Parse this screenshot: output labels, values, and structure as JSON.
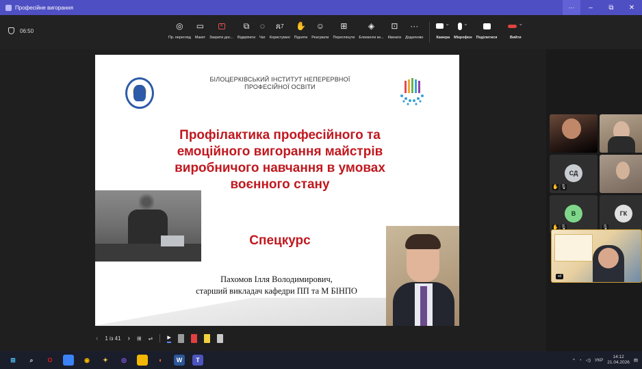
{
  "window": {
    "title": "Професійне вигорання",
    "more_label": "···",
    "minimize_label": "–",
    "restore_label": "⧉",
    "close_label": "✕"
  },
  "toolbar": {
    "timer": "06:50",
    "tools": [
      {
        "icon": "eye-icon",
        "glyph": "◎",
        "label": "Пр. перегляд"
      },
      {
        "icon": "layout-icon",
        "glyph": "▭",
        "label": "Макет"
      },
      {
        "icon": "close-share-icon",
        "glyph": "✕",
        "label": "Закрити дос..."
      },
      {
        "icon": "undock-icon",
        "glyph": "⧉",
        "label": "Відкріпити"
      },
      {
        "icon": "chat-icon",
        "glyph": "◌",
        "label": "Чат"
      },
      {
        "icon": "people-icon",
        "glyph": "ጸ",
        "label": "Користувачі",
        "count": "7"
      },
      {
        "icon": "raise-hand-icon",
        "glyph": "✋",
        "label": "Підняти"
      },
      {
        "icon": "react-icon",
        "glyph": "☺",
        "label": "Реагувати"
      },
      {
        "icon": "view-icon",
        "glyph": "⊞",
        "label": "Переглянути"
      },
      {
        "icon": "apps-icon",
        "glyph": "◈",
        "label": "Елементи ке..."
      },
      {
        "icon": "rooms-icon",
        "glyph": "⊡",
        "label": "Кімнати"
      },
      {
        "icon": "more-icon",
        "glyph": "···",
        "label": "Додатково"
      }
    ],
    "camera_label": "Камера",
    "mic_label": "Мікрофон",
    "share_label": "Поділитися",
    "leave_label": "Вийти"
  },
  "slide": {
    "institute_line1": "БІЛОЦЕРКІВСЬКИЙ ІНСТИТУТ НЕПЕРЕРВНОЇ",
    "institute_line2": "ПРОФЕСІЙНОЇ ОСВІТИ",
    "headline_1": "Профілактика професійного та",
    "headline_2": "емоційного вигорання майстрів",
    "headline_3": "виробничого навчання в умовах",
    "headline_4": "воєнного стану",
    "subtitle": "Спецкурс",
    "author_1": "Пахомов Ілля Володимирович,",
    "author_2": "старший викладач кафедри ПП та М БІНПО"
  },
  "participants": {
    "tiles": [
      {
        "initials": ""
      },
      {
        "initials": ""
      },
      {
        "initials": "СД",
        "color": "#c9ccd0"
      },
      {
        "initials": ""
      },
      {
        "initials": "В",
        "color": "#7fd68a"
      },
      {
        "initials": "ГК",
        "color": "#e0e0e0"
      }
    ]
  },
  "slidenav": {
    "counter": "1 із 41"
  },
  "taskbar": {
    "lang": "УКР",
    "time": "14:12",
    "date": "21.04.2026"
  }
}
